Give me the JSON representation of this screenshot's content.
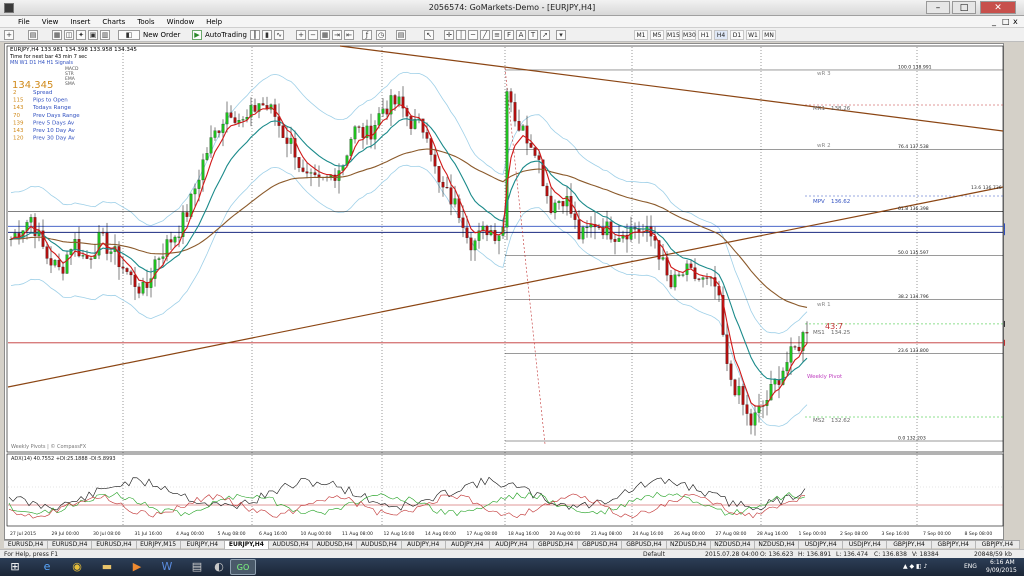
{
  "window": {
    "title": "2056574: GoMarkets-Demo - [EURJPY,H4]",
    "min_glyph": "–",
    "max_glyph": "□",
    "close_glyph": "✕"
  },
  "menu": [
    "File",
    "View",
    "Insert",
    "Charts",
    "Tools",
    "Window",
    "Help"
  ],
  "menu_mdi": {
    "min": "_",
    "restore": "□",
    "close": "x"
  },
  "toolbar": {
    "new_order": "New Order",
    "autotrading": "AutoTrading",
    "timeframes": [
      "M1",
      "M5",
      "M15",
      "M30",
      "H1",
      "H4",
      "D1",
      "W1",
      "MN"
    ]
  },
  "chart": {
    "symbol_header": "EURJPY,H4  133.981 134.398 133.958 134.345",
    "timer_text": "Time for next bar 43 min 7 sec",
    "tf_line": "MN  W1  D1  H4  H1  Signals",
    "legend_items": [
      "MACD",
      "STR",
      "EMA",
      "SMA"
    ],
    "price_big": "134.345",
    "info_rows": [
      {
        "value": "2",
        "label": "Spread"
      },
      {
        "value": "115",
        "label": "Pips to Open"
      },
      {
        "value": "143",
        "label": "Todays Range"
      },
      {
        "value": "70",
        "label": "Prev Days Range"
      },
      {
        "value": "139",
        "label": "Prev 5 Days Av"
      },
      {
        "value": "143",
        "label": "Prev 10 Day Av"
      },
      {
        "value": "120",
        "label": "Prev 30 Day Av"
      }
    ],
    "watermark": "Weekly Pivots | © CompassFX",
    "pivot_labels": [
      {
        "name": "wR 3",
        "price": ""
      },
      {
        "name": "MR1",
        "price": "138.26"
      },
      {
        "name": "wR 2",
        "price": ""
      },
      {
        "name": "MPV",
        "price": "136.62"
      },
      {
        "name": "wR 1",
        "price": ""
      },
      {
        "name": "MS1",
        "price": "134.25"
      },
      {
        "name": "Weekly Pivot",
        "price": ""
      },
      {
        "name": "MS2",
        "price": "132.62"
      }
    ],
    "fib_labels": [
      "100.0  138.991",
      "76.4  137.538",
      "61.8  136.398",
      "50.0  135.597",
      "38.2  134.796",
      "23.6  133.800",
      "0.0  132.203"
    ],
    "countdown": "43:7",
    "trend_label": "13.6  136.736",
    "price_scale": [
      "139.320",
      "138.690",
      "138.060",
      "137.430",
      "137.115",
      "136.800",
      "136.485",
      "136.170",
      "135.855",
      "135.540",
      "135.225",
      "134.910",
      "134.595",
      "134.280",
      "133.965",
      "133.650",
      "133.335",
      "133.020",
      "132.705",
      "132.390",
      "132.075"
    ],
    "price_scale_highlights": [
      {
        "label": "136.130",
        "color": "#3050c0"
      },
      {
        "label": "136.023",
        "color": "#3050c0"
      },
      {
        "label": "134.345",
        "color": "#333333"
      },
      {
        "label": "134.000",
        "color": "#c03030"
      }
    ],
    "adx_label": "ADX(14) 40.7552 +DI:25.1888 -DI:5.8993",
    "adx_scale": [
      "47",
      "40",
      "20",
      "10"
    ],
    "time_labels": [
      "27 Jul 2015",
      "29 Jul 00:00",
      "30 Jul 08:00",
      "31 Jul 16:00",
      "4 Aug 00:00",
      "5 Aug 08:00",
      "6 Aug 16:00",
      "10 Aug 00:00",
      "11 Aug 08:00",
      "12 Aug 16:00",
      "14 Aug 00:00",
      "17 Aug 08:00",
      "18 Aug 16:00",
      "20 Aug 00:00",
      "21 Aug 08:00",
      "24 Aug 16:00",
      "26 Aug 00:00",
      "27 Aug 08:00",
      "28 Aug 16:00",
      "1 Sep 00:00",
      "2 Sep 08:00",
      "3 Sep 16:00",
      "7 Sep 00:00",
      "8 Sep 08:00"
    ]
  },
  "tabs": [
    "EURUSD,H4",
    "EURUSD,H4",
    "EURUSD,H4",
    "EURJPY,M15",
    "EURJPY,H4",
    "EURJPY,H4",
    "AUDUSD,H4",
    "AUDUSD,H4",
    "AUDUSD,H4",
    "AUDJPY,H4",
    "AUDJPY,H4",
    "AUDJPY,H4",
    "GBPUSD,H4",
    "GBPUSD,H4",
    "GBPUSD,H4",
    "NZDUSD,H4",
    "NZDUSD,H4",
    "NZDUSD,H4",
    "USDJPY,H4",
    "USDJPY,H4",
    "GBPJPY,H4",
    "GBPJPY,H4",
    "GBPJPY,H4"
  ],
  "active_tab_index": 5,
  "status": {
    "help": "For Help, press F1",
    "profile": "Default",
    "datetime": "2015.07.28 04:00",
    "open": "O: 136.623",
    "high": "H: 136.891",
    "low": "L: 136.474",
    "close": "C: 136.838",
    "volume": "V: 18384",
    "traffic": "20848/59 kb"
  },
  "taskbar": {
    "lang": "ENG",
    "time": "6:16 AM",
    "date": "9/09/2015"
  },
  "colors": {
    "price_line": "#c03030",
    "ema_fast": "#d01818",
    "ema_slow": "#1a8a8a",
    "sma_200": "#8b5a2b",
    "trend": "#8b4513",
    "bands": "#9fd0e8",
    "bull": "#1fbf1f",
    "bear": "#b01010",
    "pivot_blue": "#3050c0"
  }
}
